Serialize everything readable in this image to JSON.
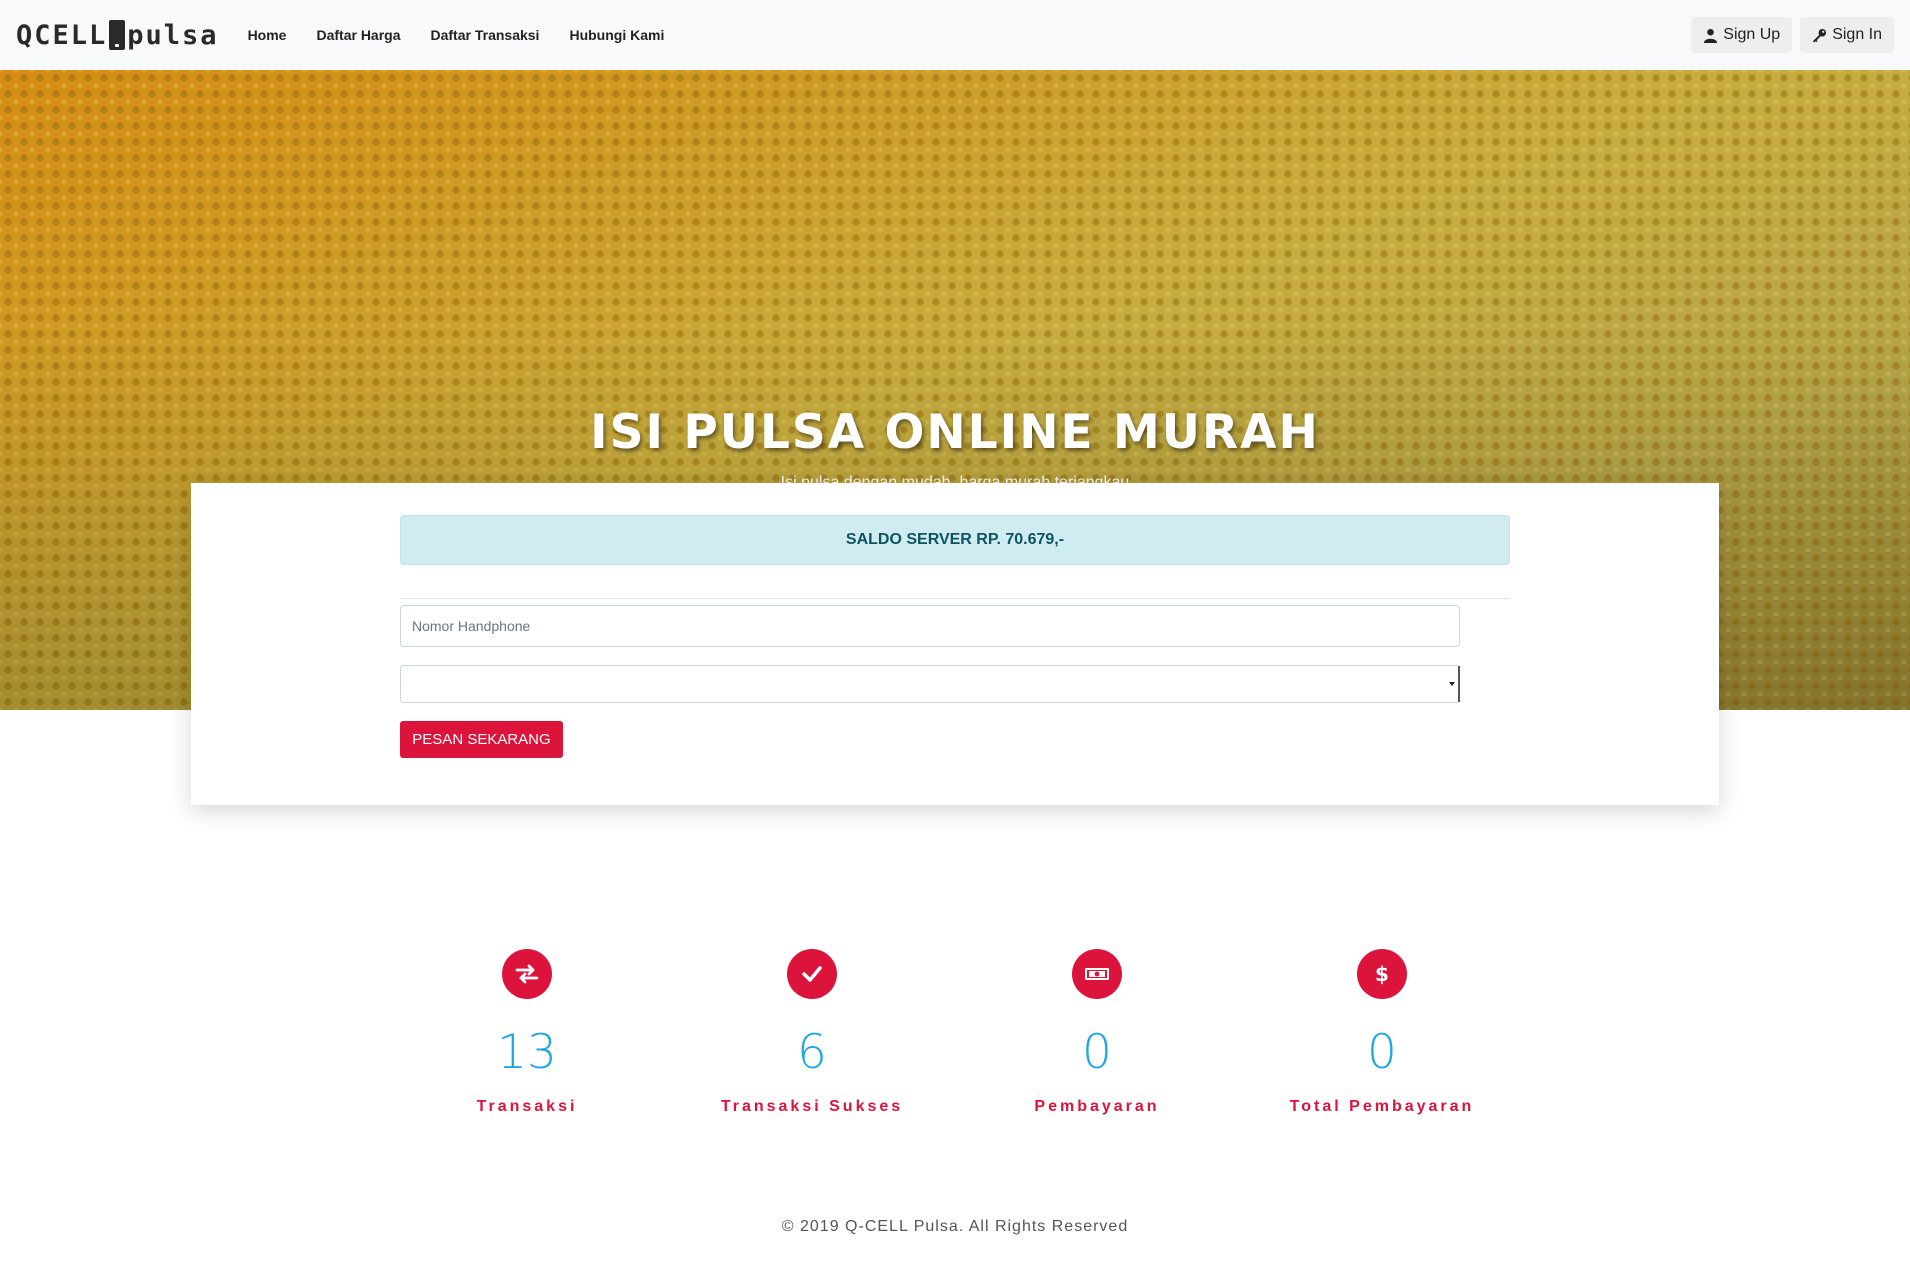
{
  "navbar": {
    "brand_left": "QCELL",
    "brand_right": "pulsa",
    "links": [
      "Home",
      "Daftar Harga",
      "Daftar Transaksi",
      "Hubungi Kami"
    ],
    "signup": "Sign Up",
    "signin": "Sign In"
  },
  "hero": {
    "title": "ISI PULSA ONLINE MURAH",
    "subtitle": "Isi pulsa dengan mudah, harga murah terjangkau"
  },
  "card": {
    "saldo": "SALDO SERVER RP. 70.679,-",
    "phone_placeholder": "Nomor Handphone",
    "select_value": "",
    "button": "PESAN SEKARANG"
  },
  "stats": [
    {
      "icon": "exchange-icon",
      "value": "13",
      "label": "Transaksi"
    },
    {
      "icon": "check-icon",
      "value": "6",
      "label": "Transaksi Sukses"
    },
    {
      "icon": "money-icon",
      "value": "0",
      "label": "Pembayaran"
    },
    {
      "icon": "dollar-icon",
      "value": "0",
      "label": "Total Pembayaran"
    }
  ],
  "footer": "© 2019 Q-CELL Pulsa. All Rights Reserved",
  "colors": {
    "accent": "#dc143c",
    "number": "#1ea7e1",
    "alert_bg": "#d1ecf1",
    "alert_text": "#0c5460"
  }
}
